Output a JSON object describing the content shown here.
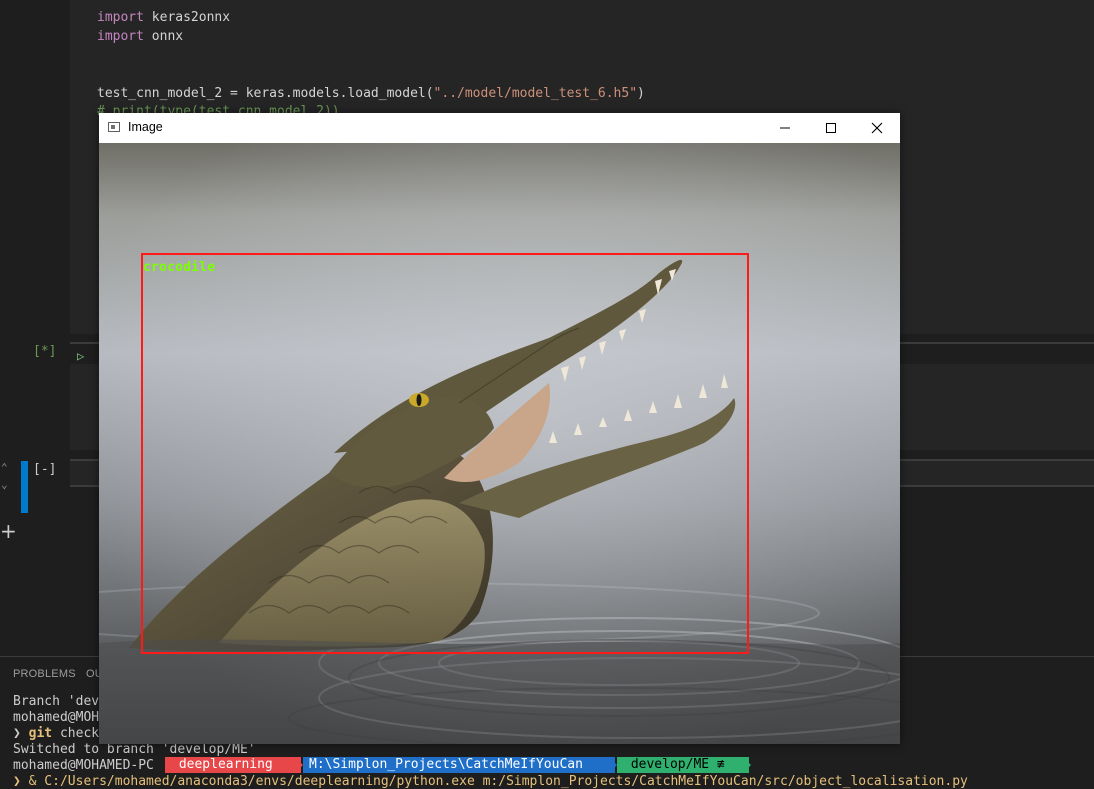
{
  "editor": {
    "code_lines": [
      {
        "kw": "import",
        "rest": " keras2onnx"
      },
      {
        "kw": "import",
        "rest": " onnx"
      },
      {
        "prefix": "test_cnn_model_2 = keras.models.load_model(",
        "str": "\"../model/model_test_6.h5\"",
        "suffix": ")"
      },
      {
        "comment": "# print(type(test_cnn_model_2))"
      }
    ],
    "cell_status_running": "[*]",
    "cell_status_idle": "[-]",
    "run_icon": "play-icon",
    "add_cell_icon": "plus-icon"
  },
  "panel": {
    "tabs": [
      "PROBLEMS",
      "OU"
    ],
    "terminal": {
      "line1": "Branch 'dev",
      "line2": "mohamed@MOH",
      "line3_arrow": "❯",
      "line3_cmd": " git",
      "line3_rest": " check",
      "line4": "Switched to branch 'develop/ME'",
      "prompt_user": "mohamed@MOHAMED-PC ",
      "seg_env": " deeplearning",
      "seg_path": "M:\\Simplon_Projects\\CatchMeIfYouCan",
      "seg_branch": " develop/ME ≢",
      "line6": "❯ & C:/Users/mohamed/anaconda3/envs/deeplearning/python.exe m:/Simplon_Projects/CatchMeIfYouCan/src/object_localisation.py"
    },
    "colors": {
      "env": "#e8474a",
      "path": "#1f6fc9",
      "branch": "#2fb06e"
    }
  },
  "image_window": {
    "title": "Image",
    "window_icon": "image-window-icon",
    "buttons": [
      "minimize-icon",
      "maximize-icon",
      "close-icon"
    ],
    "detection": {
      "label": "crocodile",
      "box_color": "#ff1a1a",
      "label_color": "#7cff00"
    }
  }
}
